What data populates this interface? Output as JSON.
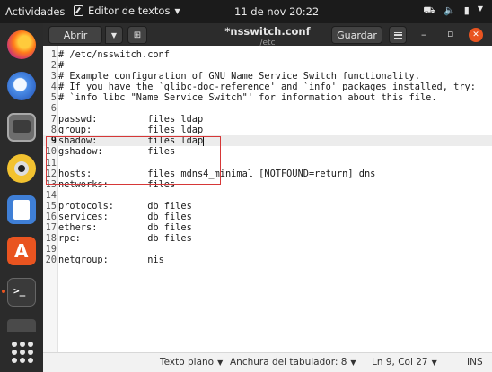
{
  "topbar": {
    "activities": "Actividades",
    "app_menu": "Editor de textos",
    "clock": "11 de nov  20:22",
    "tray_icons": [
      "network-icon",
      "volume-icon",
      "battery-icon",
      "menu-caret-icon"
    ]
  },
  "dock": {
    "apps": [
      "firefox-icon",
      "thunderbird-icon",
      "files-icon",
      "rhythmbox-icon",
      "writer-icon",
      "software-icon",
      "terminal-icon",
      "trash-icon",
      "show-apps-icon"
    ]
  },
  "headerbar": {
    "open_label": "Abrir",
    "title": "*nsswitch.conf",
    "subtitle": "/etc",
    "save_label": "Guardar"
  },
  "editor": {
    "current_line": 9,
    "lines": [
      {
        "n": "1",
        "text": "# /etc/nsswitch.conf"
      },
      {
        "n": "2",
        "text": "#"
      },
      {
        "n": "3",
        "text": "# Example configuration of GNU Name Service Switch functionality."
      },
      {
        "n": "4",
        "text": "# If you have the `glibc-doc-reference' and `info' packages installed, try:"
      },
      {
        "n": "5",
        "text": "# `info libc \"Name Service Switch\"' for information about this file."
      },
      {
        "n": "6",
        "text": ""
      },
      {
        "n": "7",
        "text": "passwd:         files ldap"
      },
      {
        "n": "8",
        "text": "group:          files ldap"
      },
      {
        "n": "9",
        "text": "shadow:         files ldap"
      },
      {
        "n": "10",
        "text": "gshadow:        files"
      },
      {
        "n": "11",
        "text": ""
      },
      {
        "n": "12",
        "text": "hosts:          files mdns4_minimal [NOTFOUND=return] dns"
      },
      {
        "n": "13",
        "text": "networks:       files"
      },
      {
        "n": "14",
        "text": ""
      },
      {
        "n": "15",
        "text": "protocols:      db files"
      },
      {
        "n": "16",
        "text": "services:       db files"
      },
      {
        "n": "17",
        "text": "ethers:         db files"
      },
      {
        "n": "18",
        "text": "rpc:            db files"
      },
      {
        "n": "19",
        "text": ""
      },
      {
        "n": "20",
        "text": "netgroup:       nis"
      }
    ]
  },
  "statusbar": {
    "language": "Texto plano",
    "tab_width": "Anchura del tabulador: 8",
    "position": "Ln 9, Col 27",
    "mode": "INS"
  },
  "colors": {
    "accent": "#e95420",
    "annotation_box": "#d63737"
  }
}
